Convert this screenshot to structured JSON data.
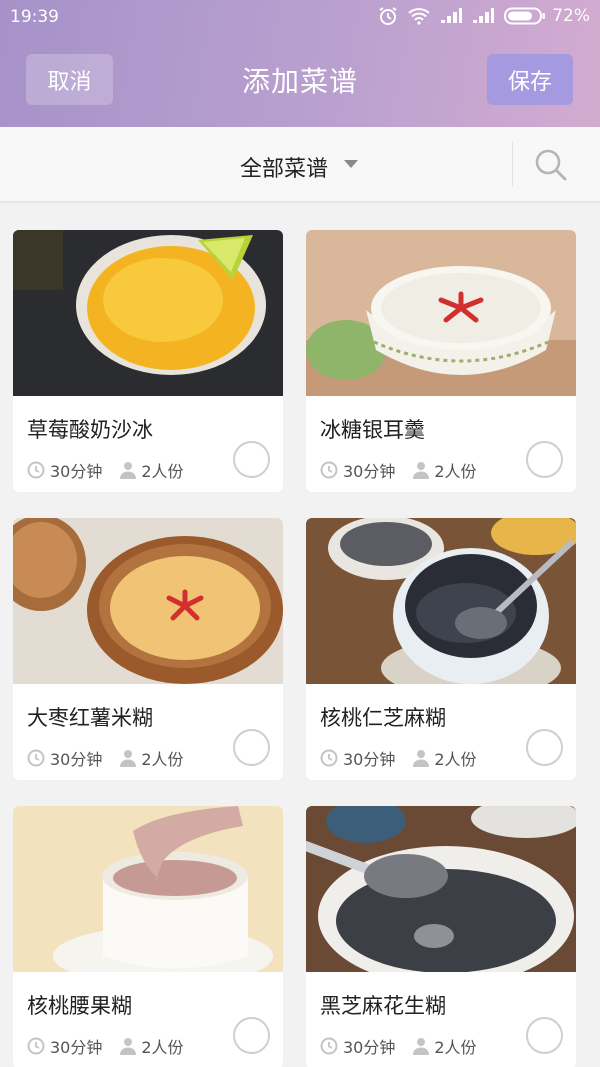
{
  "status": {
    "time": "19:39",
    "battery": "72%",
    "icons": [
      "alarm-icon",
      "wifi-icon",
      "signal-icon",
      "signal-icon",
      "battery-icon"
    ]
  },
  "header": {
    "cancel_label": "取消",
    "title": "添加菜谱",
    "save_label": "保存"
  },
  "filter": {
    "label": "全部菜谱",
    "icon": "search-icon"
  },
  "colors": {
    "header_start": "#a692c9",
    "header_end": "#d3abd0",
    "save_button": "#a59ae0"
  },
  "recipes": [
    {
      "name": "草莓酸奶沙冰",
      "time": "30分钟",
      "servings": "2人份",
      "selected": false
    },
    {
      "name": "冰糖银耳羹",
      "time": "30分钟",
      "servings": "2人份",
      "selected": false
    },
    {
      "name": "大枣红薯米糊",
      "time": "30分钟",
      "servings": "2人份",
      "selected": false
    },
    {
      "name": "核桃仁芝麻糊",
      "time": "30分钟",
      "servings": "2人份",
      "selected": false
    },
    {
      "name": "核桃腰果糊",
      "time": "30分钟",
      "servings": "2人份",
      "selected": false
    },
    {
      "name": "黑芝麻花生糊",
      "time": "30分钟",
      "servings": "2人份",
      "selected": false
    }
  ]
}
